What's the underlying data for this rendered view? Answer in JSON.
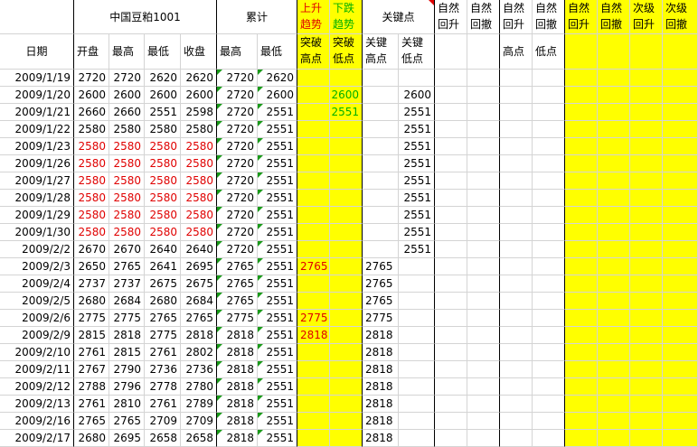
{
  "header": {
    "product": "中国豆粕1001",
    "cumulative": "累计",
    "up_trend": [
      "上升",
      "趋势"
    ],
    "down_trend": [
      "下跌",
      "趋势"
    ],
    "key_points": "关键点",
    "natural_rally_1": [
      "自然",
      "回升"
    ],
    "natural_reaction_1": [
      "自然",
      "回撤"
    ],
    "natural_rally_2": [
      "自然",
      "回升"
    ],
    "natural_reaction_2": [
      "自然",
      "回撤"
    ],
    "natural_rally_3": [
      "自然",
      "回升"
    ],
    "natural_reaction_3": [
      "自然",
      "回撤"
    ],
    "secondary_rally": [
      "次级",
      "回升"
    ],
    "secondary_reaction": [
      "次级",
      "回撤"
    ]
  },
  "subheader": {
    "date": "日期",
    "open": "开盘",
    "high": "最高",
    "low": "最低",
    "close": "收盘",
    "cum_high": "最高",
    "cum_low": "最低",
    "break_high": [
      "突破",
      "高点"
    ],
    "break_low": [
      "突破",
      "低点"
    ],
    "key_high": [
      "关键",
      "高点"
    ],
    "key_low": [
      "关键",
      "低点"
    ],
    "col_high": "高点",
    "col_low": "低点"
  },
  "rows": [
    {
      "date": "2009/1/19",
      "open": "2720",
      "high": "2720",
      "low": "2620",
      "close": "2620",
      "cum_high": "2720",
      "cum_low": "2620",
      "up": "",
      "down": "",
      "key_high": "",
      "key_low": "",
      "red": false
    },
    {
      "date": "2009/1/20",
      "open": "2600",
      "high": "2600",
      "low": "2600",
      "close": "2600",
      "cum_high": "2720",
      "cum_low": "2600",
      "up": "",
      "down": "2600",
      "key_high": "",
      "key_low": "2600",
      "red": false
    },
    {
      "date": "2009/1/21",
      "open": "2660",
      "high": "2660",
      "low": "2551",
      "close": "2598",
      "cum_high": "2720",
      "cum_low": "2551",
      "up": "",
      "down": "2551",
      "key_high": "",
      "key_low": "2551",
      "red": false
    },
    {
      "date": "2009/1/22",
      "open": "2580",
      "high": "2580",
      "low": "2580",
      "close": "2580",
      "cum_high": "2720",
      "cum_low": "2551",
      "up": "",
      "down": "",
      "key_high": "",
      "key_low": "2551",
      "red": false
    },
    {
      "date": "2009/1/23",
      "open": "2580",
      "high": "2580",
      "low": "2580",
      "close": "2580",
      "cum_high": "2720",
      "cum_low": "2551",
      "up": "",
      "down": "",
      "key_high": "",
      "key_low": "2551",
      "red": true
    },
    {
      "date": "2009/1/26",
      "open": "2580",
      "high": "2580",
      "low": "2580",
      "close": "2580",
      "cum_high": "2720",
      "cum_low": "2551",
      "up": "",
      "down": "",
      "key_high": "",
      "key_low": "2551",
      "red": true
    },
    {
      "date": "2009/1/27",
      "open": "2580",
      "high": "2580",
      "low": "2580",
      "close": "2580",
      "cum_high": "2720",
      "cum_low": "2551",
      "up": "",
      "down": "",
      "key_high": "",
      "key_low": "2551",
      "red": true
    },
    {
      "date": "2009/1/28",
      "open": "2580",
      "high": "2580",
      "low": "2580",
      "close": "2580",
      "cum_high": "2720",
      "cum_low": "2551",
      "up": "",
      "down": "",
      "key_high": "",
      "key_low": "2551",
      "red": true
    },
    {
      "date": "2009/1/29",
      "open": "2580",
      "high": "2580",
      "low": "2580",
      "close": "2580",
      "cum_high": "2720",
      "cum_low": "2551",
      "up": "",
      "down": "",
      "key_high": "",
      "key_low": "2551",
      "red": true
    },
    {
      "date": "2009/1/30",
      "open": "2580",
      "high": "2580",
      "low": "2580",
      "close": "2580",
      "cum_high": "2720",
      "cum_low": "2551",
      "up": "",
      "down": "",
      "key_high": "",
      "key_low": "2551",
      "red": true
    },
    {
      "date": "2009/2/2",
      "open": "2670",
      "high": "2670",
      "low": "2640",
      "close": "2640",
      "cum_high": "2720",
      "cum_low": "2551",
      "up": "",
      "down": "",
      "key_high": "",
      "key_low": "2551",
      "red": false
    },
    {
      "date": "2009/2/3",
      "open": "2650",
      "high": "2765",
      "low": "2641",
      "close": "2695",
      "cum_high": "2765",
      "cum_low": "2551",
      "up": "2765",
      "down": "",
      "key_high": "2765",
      "key_low": "",
      "red": false
    },
    {
      "date": "2009/2/4",
      "open": "2737",
      "high": "2737",
      "low": "2675",
      "close": "2675",
      "cum_high": "2765",
      "cum_low": "2551",
      "up": "",
      "down": "",
      "key_high": "2765",
      "key_low": "",
      "red": false
    },
    {
      "date": "2009/2/5",
      "open": "2680",
      "high": "2684",
      "low": "2680",
      "close": "2684",
      "cum_high": "2765",
      "cum_low": "2551",
      "up": "",
      "down": "",
      "key_high": "2765",
      "key_low": "",
      "red": false
    },
    {
      "date": "2009/2/6",
      "open": "2775",
      "high": "2775",
      "low": "2765",
      "close": "2765",
      "cum_high": "2775",
      "cum_low": "2551",
      "up": "2775",
      "down": "",
      "key_high": "2775",
      "key_low": "",
      "red": false
    },
    {
      "date": "2009/2/9",
      "open": "2815",
      "high": "2818",
      "low": "2775",
      "close": "2818",
      "cum_high": "2818",
      "cum_low": "2551",
      "up": "2818",
      "down": "",
      "key_high": "2818",
      "key_low": "",
      "red": false
    },
    {
      "date": "2009/2/10",
      "open": "2761",
      "high": "2815",
      "low": "2761",
      "close": "2802",
      "cum_high": "2818",
      "cum_low": "2551",
      "up": "",
      "down": "",
      "key_high": "2818",
      "key_low": "",
      "red": false
    },
    {
      "date": "2009/2/11",
      "open": "2767",
      "high": "2790",
      "low": "2736",
      "close": "2736",
      "cum_high": "2818",
      "cum_low": "2551",
      "up": "",
      "down": "",
      "key_high": "2818",
      "key_low": "",
      "red": false
    },
    {
      "date": "2009/2/12",
      "open": "2788",
      "high": "2796",
      "low": "2778",
      "close": "2780",
      "cum_high": "2818",
      "cum_low": "2551",
      "up": "",
      "down": "",
      "key_high": "2818",
      "key_low": "",
      "red": false
    },
    {
      "date": "2009/2/13",
      "open": "2761",
      "high": "2810",
      "low": "2761",
      "close": "2789",
      "cum_high": "2818",
      "cum_low": "2551",
      "up": "",
      "down": "",
      "key_high": "2818",
      "key_low": "",
      "red": false
    },
    {
      "date": "2009/2/16",
      "open": "2765",
      "high": "2765",
      "low": "2709",
      "close": "2709",
      "cum_high": "2818",
      "cum_low": "2551",
      "up": "",
      "down": "",
      "key_high": "2818",
      "key_low": "",
      "red": false
    },
    {
      "date": "2009/2/17",
      "open": "2680",
      "high": "2695",
      "low": "2658",
      "close": "2658",
      "cum_high": "2818",
      "cum_low": "2551",
      "up": "",
      "down": "",
      "key_high": "2818",
      "key_low": "",
      "red": false
    }
  ],
  "colors": {
    "highlight": "#ffff00",
    "price_red": "#e00000",
    "trend_green": "#00b000",
    "grid": "#d4d4d4"
  }
}
